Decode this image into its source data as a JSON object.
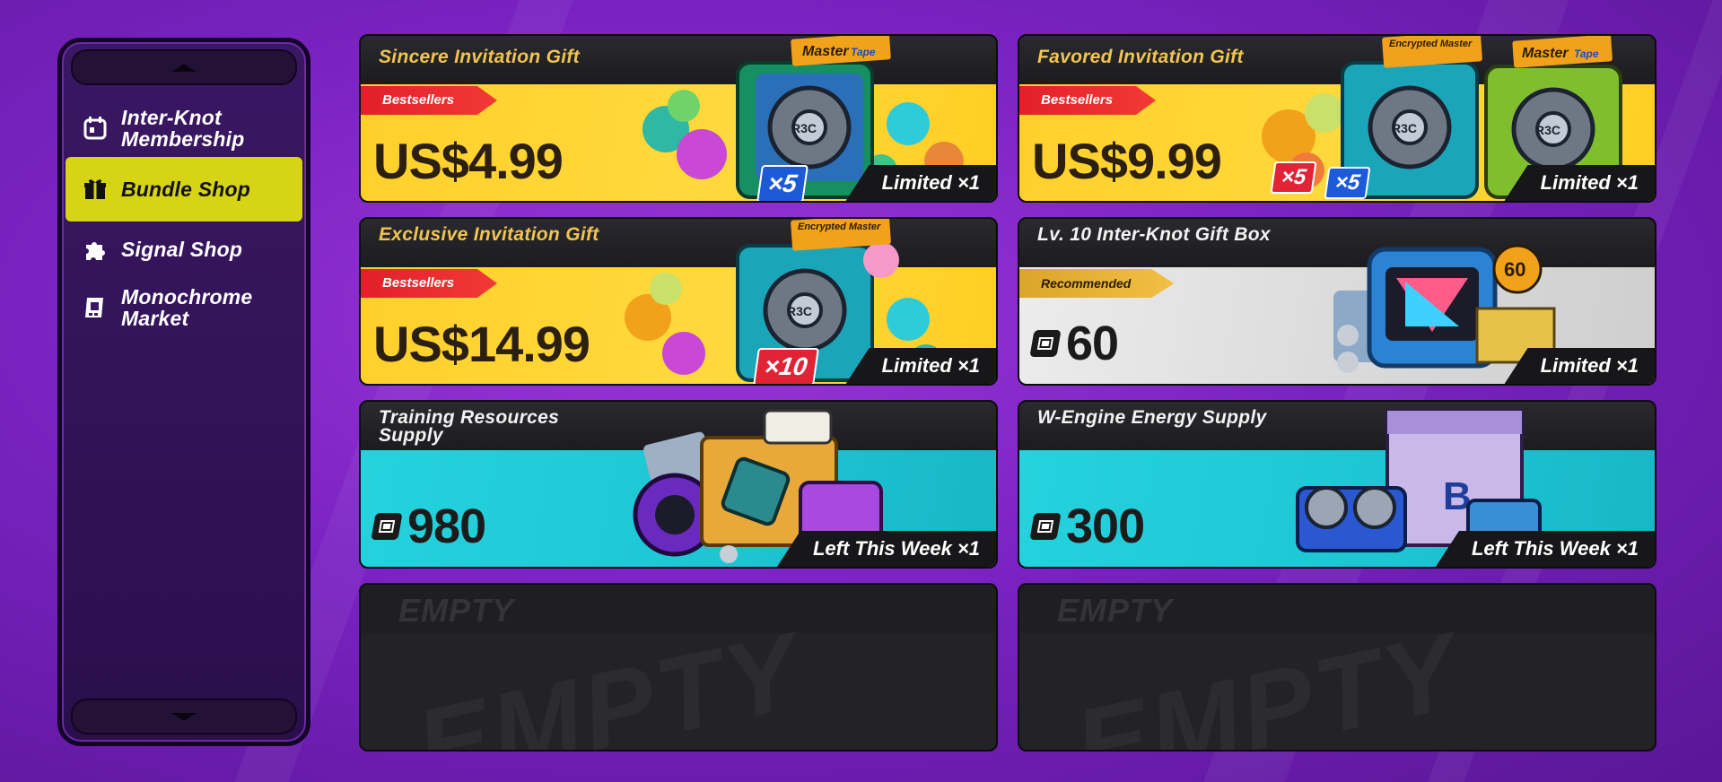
{
  "sidebar": {
    "items": [
      {
        "label": "Inter-Knot Membership",
        "icon": "calendar-icon"
      },
      {
        "label": "Bundle Shop",
        "icon": "gift-icon"
      },
      {
        "label": "Signal Shop",
        "icon": "puzzle-icon"
      },
      {
        "label": "Monochrome Market",
        "icon": "film-card-icon"
      }
    ],
    "active": "Bundle Shop"
  },
  "cards": [
    {
      "title": "Sincere Invitation Gift",
      "badge": "Bestsellers",
      "price": "US$4.99",
      "limit": "Limited ×1",
      "qty": [
        "×5"
      ]
    },
    {
      "title": "Favored Invitation Gift",
      "badge": "Bestsellers",
      "price": "US$9.99",
      "limit": "Limited ×1",
      "qty": [
        "×5",
        "×5"
      ]
    },
    {
      "title": "Exclusive Invitation Gift",
      "badge": "Bestsellers",
      "price": "US$14.99",
      "limit": "Limited ×1",
      "qty": [
        "×10"
      ]
    },
    {
      "title": "Lv. 10 Inter-Knot Gift Box",
      "badge": "Recommended",
      "cost": "60",
      "limit": "Limited ×1",
      "item_number": "60"
    },
    {
      "title": "Training Resources Supply",
      "cost": "980",
      "limit": "Left This Week ×1"
    },
    {
      "title": "W-Engine Energy Supply",
      "cost": "300",
      "limit": "Left This Week ×1"
    }
  ],
  "empty_slots": [
    {
      "label": "EMPTY"
    },
    {
      "label": "EMPTY"
    }
  ],
  "tape_labels": {
    "master": "Master",
    "encrypted": "Encrypted Master",
    "tape": "Tape",
    "disc": "R3C",
    "crate_letter": "B"
  },
  "colors": {
    "yellow": "#ffd02a",
    "cyan": "#1ec6d4",
    "accent": "#d6d414",
    "badge_red": "#e21e2a"
  }
}
